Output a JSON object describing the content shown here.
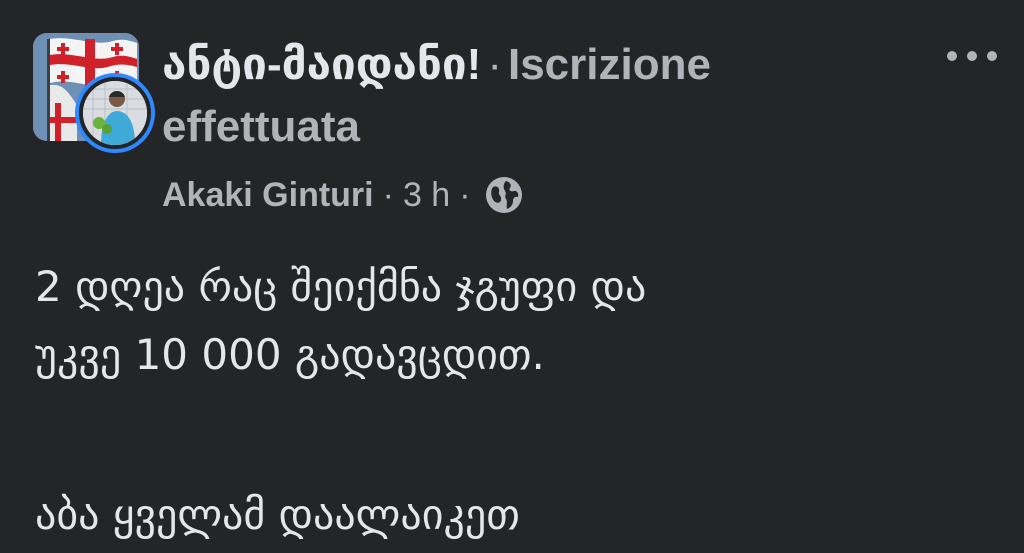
{
  "post": {
    "group_name": "ანტი-მაიდანი!",
    "separator": "·",
    "join_status": "Iscrizione effettuata",
    "author": "Akaki Ginturi",
    "time": "3 h",
    "privacy_icon": "globe-icon",
    "more_icon": "more-options-icon",
    "body_lines": [
      "2 დღეა რაც შეიქმნა ჯგუფი და",
      "უკვე 10 000 გადავცდით.",
      "აბა ყველამ დაალაიკეთ"
    ]
  },
  "colors": {
    "background": "#242526",
    "primary_text": "#e4e6eb",
    "secondary_text": "#b0b3b8",
    "avatar_ring": "#2e89ff"
  }
}
